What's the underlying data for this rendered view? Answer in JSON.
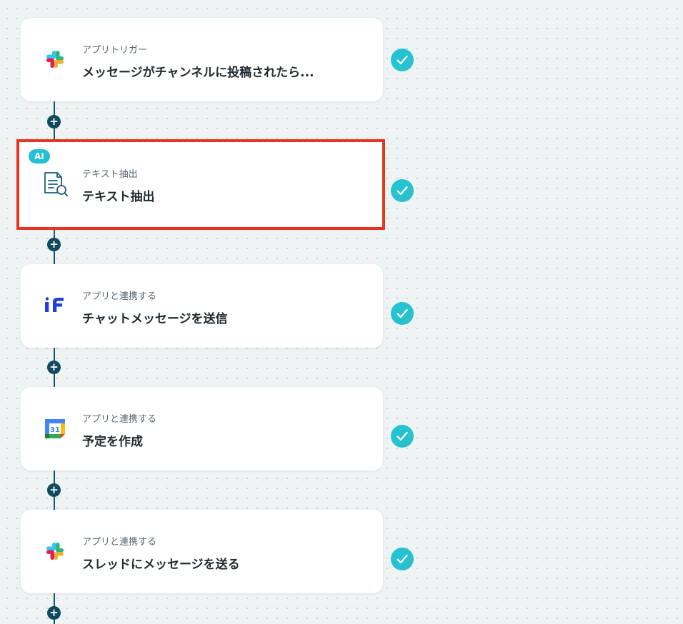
{
  "colors": {
    "connector": "#1f5168",
    "add_button": "#0f4a5f",
    "check": "#22c4d6",
    "selection_border": "#e8341c",
    "ai_badge": "#24c0d8"
  },
  "add_button_label": "+",
  "steps": [
    {
      "kind": "アプリトリガー",
      "title": "メッセージがチャンネルに投稿されたら...",
      "icon": "slack-icon",
      "status": "completed",
      "selected": false
    },
    {
      "kind": "テキスト抽出",
      "title": "テキスト抽出",
      "icon": "document-search-icon",
      "badge": "AI",
      "status": "completed",
      "selected": true
    },
    {
      "kind": "アプリと連携する",
      "title": "チャットメッセージを送信",
      "icon": "if-icon",
      "status": "completed",
      "selected": false
    },
    {
      "kind": "アプリと連携する",
      "title": "予定を作成",
      "icon": "google-calendar-icon",
      "icon_text": "31",
      "status": "completed",
      "selected": false
    },
    {
      "kind": "アプリと連携する",
      "title": "スレッドにメッセージを送る",
      "icon": "slack-icon",
      "status": "completed",
      "selected": false
    }
  ]
}
